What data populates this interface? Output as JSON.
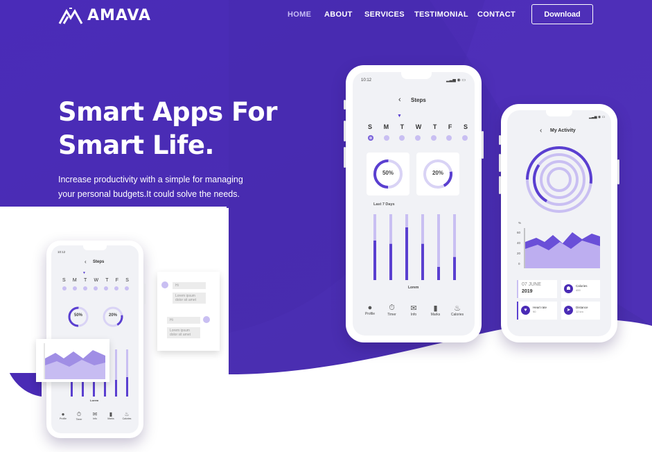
{
  "brand": {
    "name": "AMAVA"
  },
  "nav": {
    "items": [
      {
        "label": "HOME",
        "active": true
      },
      {
        "label": "ABOUT",
        "active": false
      },
      {
        "label": "SERVICES",
        "active": false
      },
      {
        "label": "TESTIMONIAL",
        "active": false
      },
      {
        "label": "CONTACT",
        "active": false
      }
    ],
    "download_label": "Download"
  },
  "hero": {
    "headline_line1": "Smart Apps For",
    "headline_line2": "Smart Life.",
    "subtext_line1": "Increase productivity with a simple for managing",
    "subtext_line2": "your personal budgets.It could solve the needs."
  },
  "colors": {
    "primary": "#4a2bb5",
    "primary_dark": "#3a1f9e",
    "accent": "#5a3fd0",
    "light_accent": "#b7a9ee"
  },
  "phone_steps": {
    "time": "10:12",
    "title": "Steps",
    "days": [
      "S",
      "M",
      "T",
      "W",
      "T",
      "F",
      "S"
    ],
    "ring1": "50%",
    "ring2": "20%",
    "chart_label": "Last 7 Days",
    "chart_x_label": "Lorem",
    "bar_fill": [
      0.6,
      0.55,
      0.8,
      0.55,
      0.2,
      0.35
    ],
    "tabs": [
      "Profile",
      "Timer",
      "Info",
      "Marks",
      "Calories"
    ]
  },
  "phone_activity": {
    "title": "My Activity",
    "y_unit": "%",
    "y_ticks": [
      "60",
      "40",
      "20",
      "0"
    ],
    "date_line1": "07 JUNE",
    "date_line2": "2019",
    "tile_calories": "Calories",
    "tile_calories_val": "400",
    "tile_heart": "Heart rate",
    "tile_heart_val": "90",
    "tile_distance": "Distance",
    "tile_distance_val": "12 km"
  },
  "small_phone": {
    "time": "10:12",
    "title": "Steps",
    "days": [
      "S",
      "M",
      "T",
      "W",
      "T",
      "F",
      "S"
    ],
    "ring1": "50%",
    "ring2": "20%",
    "chart_x_label": "Lorem",
    "tabs": [
      "Profile",
      "Timer",
      "Info",
      "Marks",
      "Calories"
    ]
  },
  "chat": {
    "msg1": "Hi",
    "msg2": "Lorem ipsum dolor sit amet",
    "msg3": "Hi",
    "msg4": "Lorem ipsum dolor sit amet"
  }
}
